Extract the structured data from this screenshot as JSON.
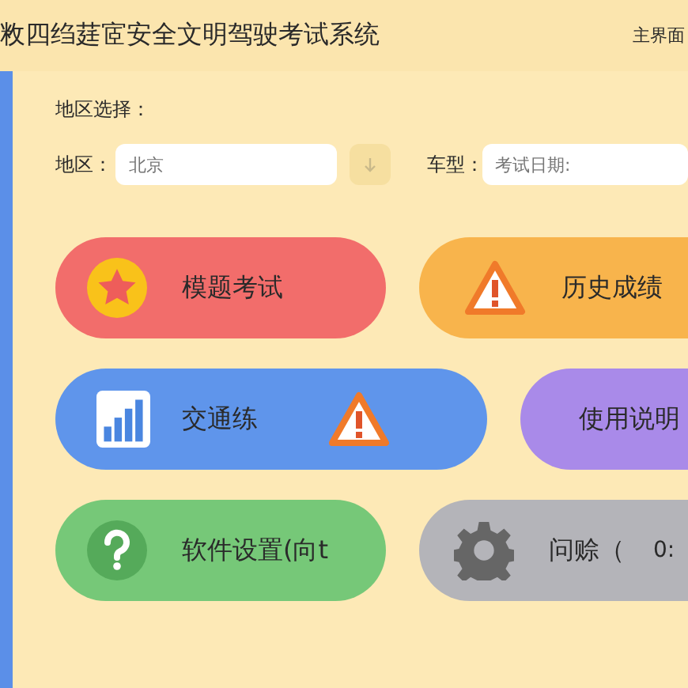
{
  "header": {
    "title": "敉四绉莛宧安全文明驾驶考试系统",
    "link": "主界面"
  },
  "region": {
    "heading": "地区选择：",
    "region_label": "地区：",
    "region_placeholder": "北京",
    "car_label": "车型：",
    "car_placeholder": "考试日期:"
  },
  "buttons": [
    {
      "label": "模题考试",
      "color": "#f26d6b",
      "icons": [
        {
          "kind": "star"
        }
      ]
    },
    {
      "label": "历史成绩",
      "color": "#f8b44c",
      "icons": [
        {
          "kind": "warning"
        }
      ]
    },
    {
      "label": "交通练",
      "color": "#5f95eb",
      "icons": [
        {
          "kind": "chart"
        },
        {
          "kind": "warning"
        }
      ]
    },
    {
      "label": "使用说明",
      "color": "#a98ae9"
    },
    {
      "label": "软件设置(向t",
      "color": "#76c878",
      "icons": [
        {
          "kind": "help"
        }
      ]
    },
    {
      "label": "问赊（",
      "extra": "0:",
      "color": "#b4b4b9",
      "icons": [
        {
          "kind": "gear"
        }
      ]
    }
  ]
}
